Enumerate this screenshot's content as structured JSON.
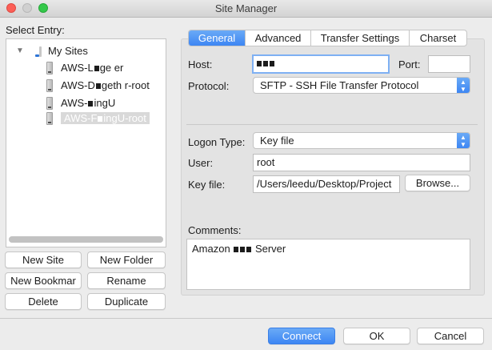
{
  "window": {
    "title": "Site Manager"
  },
  "select_entry_label": "Select Entry:",
  "tree": {
    "root_label": "My Sites",
    "items": [
      {
        "label_start": "AWS-L",
        "label_end": "ge  er"
      },
      {
        "label_start": "AWS-D",
        "label_end": "geth  r-root"
      },
      {
        "label_start": "AWS-",
        "label_end": "ingU"
      },
      {
        "label_start": "AWS-F",
        "label_end": "ingU-root"
      }
    ]
  },
  "left_buttons": {
    "new_site": "New Site",
    "new_folder": "New Folder",
    "new_bookmark": "New Bookmar",
    "rename": "Rename",
    "delete": "Delete",
    "duplicate": "Duplicate"
  },
  "tabs": [
    "General",
    "Advanced",
    "Transfer Settings",
    "Charset"
  ],
  "general": {
    "host_label": "Host:",
    "host_value": "",
    "port_label": "Port:",
    "port_value": "",
    "protocol_label": "Protocol:",
    "protocol_value": "SFTP - SSH File Transfer Protocol",
    "logon_type_label": "Logon Type:",
    "logon_type_value": "Key file",
    "user_label": "User:",
    "user_value": "root",
    "key_file_label": "Key file:",
    "key_file_value": "/Users/leedu/Desktop/Project",
    "browse_label": "Browse...",
    "comments_label": "Comments:",
    "comments_start": "Amazon",
    "comments_end": "Server"
  },
  "footer": {
    "connect": "Connect",
    "ok": "OK",
    "cancel": "Cancel"
  },
  "colors": {
    "accent": "#3d86f3",
    "close": "#fc5f57",
    "maximize": "#34c84a"
  }
}
